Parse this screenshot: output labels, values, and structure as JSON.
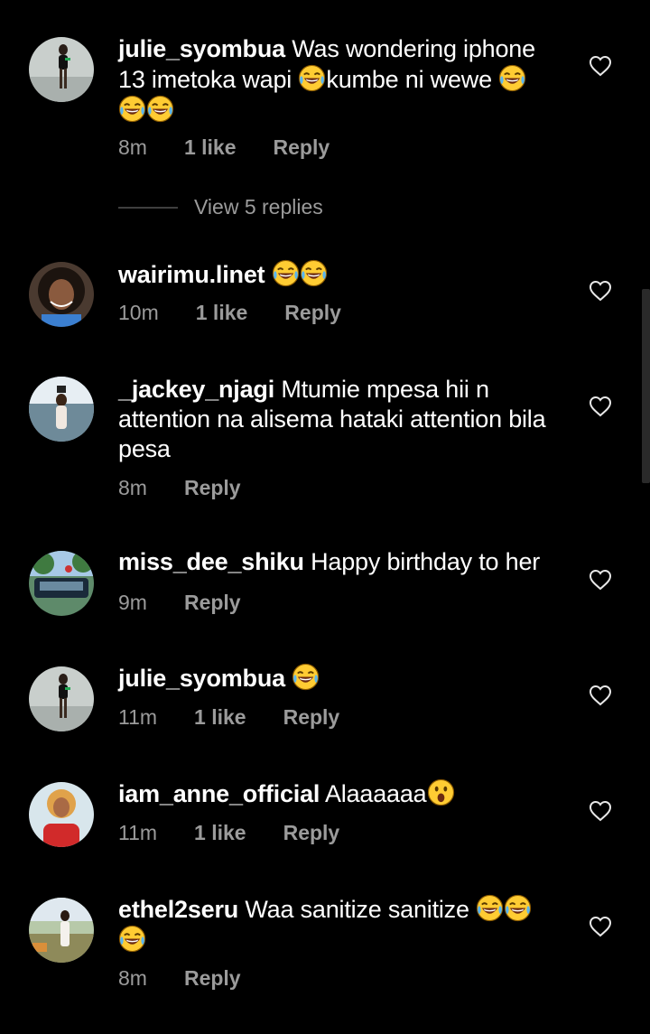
{
  "comments": [
    {
      "username": "julie_syombua",
      "text_parts": [
        " Was wondering iphone 13 imetoka wapi ",
        "[laugh]",
        "kumbe ni wewe ",
        "[laugh]",
        " ",
        "[laugh]",
        "[laugh]"
      ],
      "text_before": " Was wondering iphone 13 imetoka wapi ",
      "text_middle": "kumbe ni wewe ",
      "time": "8m",
      "likes": "1 like",
      "reply": "Reply",
      "view_replies": "View 5 replies"
    },
    {
      "username": "wairimu.linet",
      "text": "",
      "time": "10m",
      "likes": "1 like",
      "reply": "Reply"
    },
    {
      "username": "_jackey_njagi",
      "text": " Mtumie mpesa hii n attention na alisema hataki attention bila pesa",
      "time": "8m",
      "reply": "Reply"
    },
    {
      "username": "miss_dee_shiku",
      "text": " Happy birthday to her",
      "time": "9m",
      "reply": "Reply"
    },
    {
      "username": "julie_syombua",
      "text": " ",
      "time": "11m",
      "likes": "1 like",
      "reply": "Reply"
    },
    {
      "username": "iam_anne_official",
      "text": " Alaaaaaa",
      "time": "11m",
      "likes": "1 like",
      "reply": "Reply"
    },
    {
      "username": "ethel2seru",
      "text": " Waa sanitize sanitize ",
      "time": "8m",
      "reply": "Reply"
    }
  ],
  "icons": {
    "like": "heart-outline-icon",
    "laugh": "face-with-tears-of-joy-emoji",
    "surprise": "face-with-open-mouth-emoji"
  },
  "colors": {
    "background": "#000000",
    "text": "#ffffff",
    "meta": "#9b9b9b"
  }
}
